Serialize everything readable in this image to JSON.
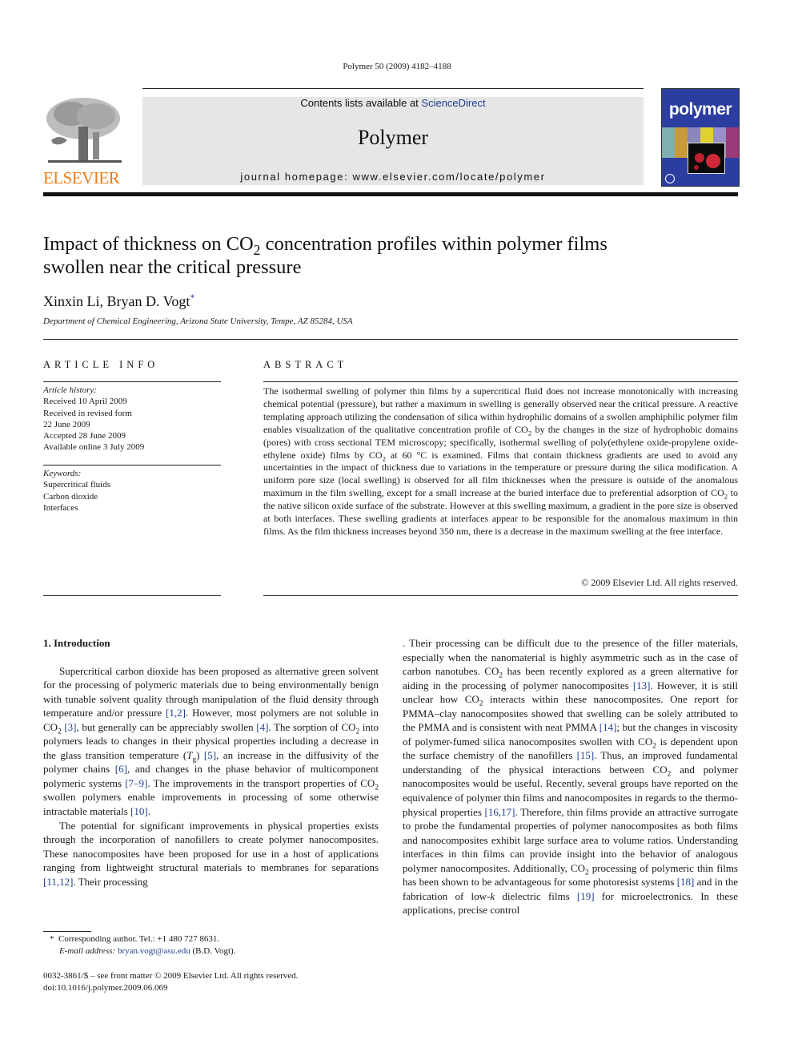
{
  "header": {
    "citation": "Polymer 50 (2009) 4182–4188",
    "contents_prefix": "Contents lists available at ",
    "contents_link": "ScienceDirect",
    "journal_name": "Polymer",
    "homepage": "journal homepage: www.elsevier.com/locate/polymer",
    "publisher_logo_text": "ELSEVIER",
    "cover_title": "polymer"
  },
  "colors": {
    "link": "#1f3f8f",
    "elsevier_orange": "#f07c16",
    "banner_bg": "#e6e6e6",
    "cover_blue": "#2c3da0"
  },
  "article": {
    "title_part1": "Impact of thickness on CO",
    "title_sub": "2",
    "title_part2": " concentration profiles within polymer films swollen near the critical pressure",
    "authors": "Xinxin Li, Bryan D. Vogt",
    "author_mark": "*",
    "affiliation": "Department of Chemical Engineering, Arizona State University, Tempe, AZ 85284, USA"
  },
  "article_info": {
    "heading": "ARTICLE INFO",
    "history_label": "Article history:",
    "history": [
      "Received 10 April 2009",
      "Received in revised form",
      "22 June 2009",
      "Accepted 28 June 2009",
      "Available online 3 July 2009"
    ],
    "keywords_label": "Keywords:",
    "keywords": [
      "Supercritical fluids",
      "Carbon dioxide",
      "Interfaces"
    ]
  },
  "abstract": {
    "heading": "ABSTRACT",
    "s1": "The isothermal swelling of polymer thin films by a supercritical fluid does not increase monotonically with increasing chemical potential (pressure), but rather a maximum in swelling is generally observed near the critical pressure. A reactive templating approach utilizing the condensation of silica within hydrophilic domains of a swollen amphiphilic polymer film enables visualization of the qualitative concentration profile of CO",
    "s2": " by the changes in the size of hydrophobic domains (pores) with cross sectional TEM microscopy; specifically, isothermal swelling of poly(ethylene oxide-propylene oxide-ethylene oxide) films by CO",
    "s3": " at 60 °C is examined. Films that contain thickness gradients are used to avoid any uncertainties in the impact of thickness due to variations in the temperature or pressure during the silica modification. A uniform pore size (local swelling) is observed for all film thicknesses when the pressure is outside of the anomalous maximum in the film swelling, except for a small increase at the buried interface due to preferential adsorption of CO",
    "s4": " to the native silicon oxide surface of the substrate. However at this swelling maximum, a gradient in the pore size is observed at both interfaces. These swelling gradients at interfaces appear to be responsible for the anomalous maximum in thin films. As the film thickness increases beyond 350 nm, there is a decrease in the maximum swelling at the free interface.",
    "copyright": "© 2009 Elsevier Ltd. All rights reserved."
  },
  "intro": {
    "heading": "1.  Introduction",
    "p1": {
      "a": "Supercritical carbon dioxide has been proposed as alternative green solvent for the processing of polymeric materials due to being environmentally benign with tunable solvent quality through manipulation of the fluid density through temperature and/or pressure ",
      "r1": "[1,2]",
      "b": ". However, most polymers are not soluble in CO",
      "c": " ",
      "r2": "[3]",
      "d": ", but generally can be appreciably swollen ",
      "r3": "[4]",
      "e": ". The sorption of CO",
      "f": " into polymers leads to changes in their physical properties including a decrease in the glass transition temperature (",
      "tg": "T",
      "tg_sub": "g",
      "g": ") ",
      "r4": "[5]",
      "h": ", an increase in the diffusivity of the polymer chains ",
      "r5": "[6]",
      "i": ", and changes in the phase behavior of multicomponent polymeric systems ",
      "r6": "[7–9]",
      "j": ". The improvements in the transport properties of CO",
      "k": " swollen polymers enable improvements in processing of some otherwise intractable materials ",
      "r7": "[10]",
      "l": "."
    },
    "p2": {
      "a": "The potential for significant improvements in physical properties exists through the incorporation of nanofillers to create polymer nanocomposites. These nanocomposites have been proposed for use in a host of applications ranging from lightweight structural materials to membranes for separations ",
      "r1": "[11,12]",
      "b": ". Their processing can be difficult due to the presence of the filler materials, especially when the nanomaterial is highly asymmetric such as in the case of carbon nanotubes. CO",
      "c": " has been recently explored as a green alternative for aiding in the processing of polymer nanocomposites ",
      "r2": "[13]",
      "d": ". However, it is still unclear how CO",
      "e": " interacts within these nanocomposites. One report for PMMA–clay nanocomposites showed that swelling can be solely attributed to the PMMA and is consistent with neat PMMA ",
      "r3": "[14]",
      "f": "; but the changes in viscosity of polymer-fumed silica nanocomposites swollen with CO",
      "g": " is dependent upon the surface chemistry of the nanofillers ",
      "r4": "[15]",
      "h": ". Thus, an improved fundamental understanding of the physical interactions between CO",
      "i": " and polymer nanocomposites would be useful. Recently, several groups have reported on the equivalence of polymer thin films and nanocomposites in regards to the thermo-physical properties ",
      "r5": "[16,17]",
      "j": ". Therefore, thin films provide an attractive surrogate to probe the fundamental properties of polymer nanocomposites as both films and nanocomposites exhibit large surface area to volume ratios. Understanding interfaces in thin films can provide insight into the behavior of analogous polymer nanocomposites. Additionally, CO",
      "k": " processing of polymeric thin films has been shown to be advantageous for some photoresist systems ",
      "r6": "[18]",
      "l": " and in the fabrication of low-",
      "kk": "k",
      "m": " dielectric films ",
      "r7": "[19]",
      "n": " for microelectronics. In these applications, precise control"
    },
    "sub2": "2"
  },
  "footnote": {
    "mark": "*",
    "text": "Corresponding author. Tel.: +1 480 727 8631.",
    "email_label": "E-mail address:",
    "email": "bryan.vogt@asu.edu",
    "email_suffix": " (B.D. Vogt)."
  },
  "front_matter": {
    "issn_line": "0032-3861/$ – see front matter © 2009 Elsevier Ltd. All rights reserved.",
    "doi": "doi:10.1016/j.polymer.2009.06.069"
  }
}
